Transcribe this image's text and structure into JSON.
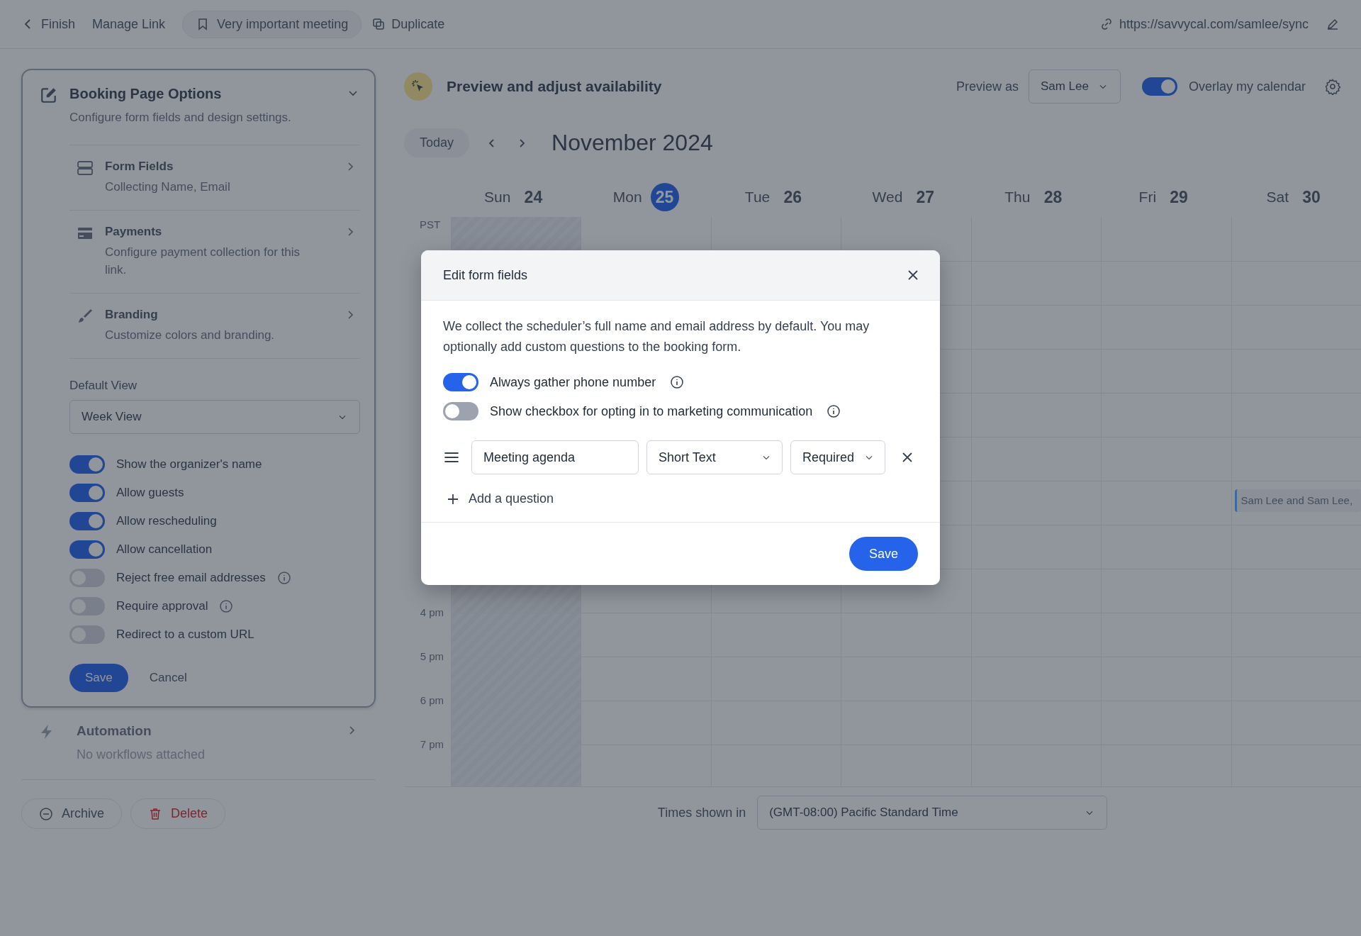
{
  "top_bar": {
    "back": "Finish",
    "manage": "Manage Link",
    "meeting": "Very important meeting",
    "duplicate": "Duplicate",
    "url": "https://savvycal.com/samlee/sync"
  },
  "panel": {
    "title": "Booking Page Options",
    "subtitle": "Configure form fields and design settings.",
    "items": [
      {
        "kind": "fields",
        "title": "Form Fields",
        "subtitle": "Collecting Name, Email"
      },
      {
        "kind": "card",
        "title": "Payments",
        "subtitle": "Configure payment collection for this link."
      },
      {
        "kind": "brush",
        "title": "Branding",
        "subtitle": "Customize colors and branding."
      }
    ],
    "default_view": {
      "label": "Default View",
      "value": "Week View"
    },
    "toggles": [
      {
        "label": "Show the organizer's name",
        "on": true,
        "info": false
      },
      {
        "label": "Allow guests",
        "on": true,
        "info": false
      },
      {
        "label": "Allow rescheduling",
        "on": true,
        "info": false
      },
      {
        "label": "Allow cancellation",
        "on": true,
        "info": false
      },
      {
        "label": "Reject free email addresses",
        "on": false,
        "info": true
      },
      {
        "label": "Require approval",
        "on": false,
        "info": true
      },
      {
        "label": "Redirect to a custom URL",
        "on": false,
        "info": false
      }
    ],
    "save": "Save",
    "cancel": "Cancel"
  },
  "automation": {
    "title": "Automation",
    "subtitle": "No workflows attached"
  },
  "actions": [
    {
      "kind": "archive",
      "label": "Archive"
    },
    {
      "kind": "delete",
      "label": "Delete"
    }
  ],
  "preview": {
    "title": "Preview and adjust availability",
    "preview_as_label": "Preview as",
    "preview_as": "Sam Lee",
    "overlay": {
      "label": "Overlay my calendar",
      "on": true
    }
  },
  "calendar": {
    "today": "Today",
    "month": "November 2024",
    "zone": "PST",
    "days": [
      {
        "name": "Sun",
        "date": "24",
        "selected": false,
        "past": true
      },
      {
        "name": "Mon",
        "date": "25",
        "selected": true,
        "past": false
      },
      {
        "name": "Tue",
        "date": "26",
        "selected": false,
        "past": false
      },
      {
        "name": "Wed",
        "date": "27",
        "selected": false,
        "past": false
      },
      {
        "name": "Thu",
        "date": "28",
        "selected": false,
        "past": false
      },
      {
        "name": "Fri",
        "date": "29",
        "selected": false,
        "past": false
      },
      {
        "name": "Sat",
        "date": "30",
        "selected": false,
        "past": false,
        "events": [
          {
            "title": "Sam Lee and Sam Lee,"
          }
        ]
      }
    ],
    "time_labels": [
      "4 pm",
      "5 pm",
      "6 pm",
      "7 pm"
    ],
    "times_shown_label": "Times shown in",
    "timezone": "(GMT-08:00) Pacific Standard Time"
  },
  "modal": {
    "title": "Edit form fields",
    "description": "We collect the scheduler’s full name and email address by default. You may optionally add custom questions to the booking form.",
    "toggles": [
      {
        "label": "Always gather phone number",
        "on": true
      },
      {
        "label": "Show checkbox for opting in to marketing communication",
        "on": false
      }
    ],
    "questions": [
      {
        "label": "Meeting agenda",
        "type": "Short Text",
        "requirement": "Required"
      }
    ],
    "add": "Add a question",
    "save": "Save"
  }
}
